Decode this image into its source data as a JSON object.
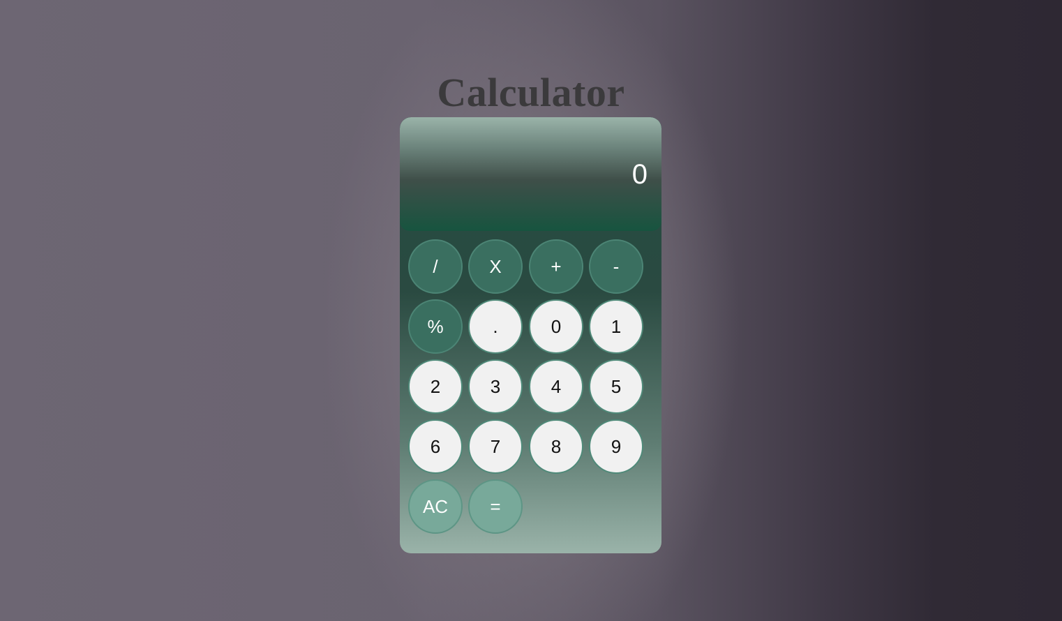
{
  "page": {
    "title": "Calculator"
  },
  "calculator": {
    "display_value": "0",
    "keys": [
      {
        "label": "/",
        "kind": "operator"
      },
      {
        "label": "X",
        "kind": "operator"
      },
      {
        "label": "+",
        "kind": "operator"
      },
      {
        "label": "-",
        "kind": "operator"
      },
      {
        "label": "%",
        "kind": "operator"
      },
      {
        "label": ".",
        "kind": "number"
      },
      {
        "label": "0",
        "kind": "number"
      },
      {
        "label": "1",
        "kind": "number"
      },
      {
        "label": "2",
        "kind": "number"
      },
      {
        "label": "3",
        "kind": "number"
      },
      {
        "label": "4",
        "kind": "number"
      },
      {
        "label": "5",
        "kind": "number"
      },
      {
        "label": "6",
        "kind": "number"
      },
      {
        "label": "7",
        "kind": "number"
      },
      {
        "label": "8",
        "kind": "number"
      },
      {
        "label": "9",
        "kind": "number"
      },
      {
        "label": "AC",
        "kind": "action"
      },
      {
        "label": "=",
        "kind": "action"
      }
    ]
  },
  "colors": {
    "operator_key": "#3a6f60",
    "number_key": "#f1f1f1",
    "action_key": "#78a99a",
    "title_text": "#3b3a3c"
  }
}
